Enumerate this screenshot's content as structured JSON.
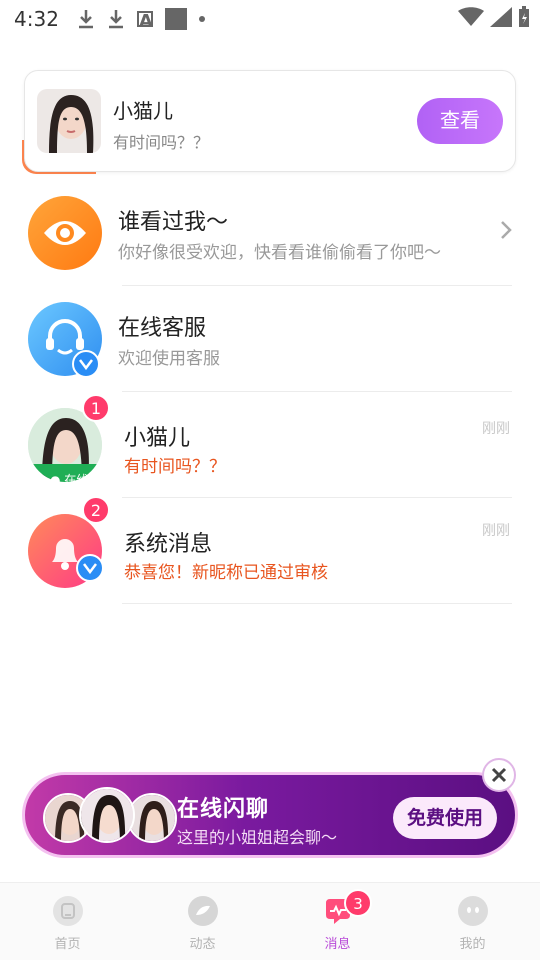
{
  "status_bar": {
    "time": "4:32"
  },
  "top_card": {
    "name": "小猫儿",
    "subtitle": "有时间吗？？",
    "button_label": "查看"
  },
  "list": [
    {
      "title": "谁看过我～",
      "subtitle": "你好像很受欢迎，快看看谁偷偷看了你吧～",
      "icon": "eye-icon",
      "color": "#ff8a1f"
    },
    {
      "title": "在线客服",
      "subtitle": "欢迎使用客服",
      "icon": "headset-icon",
      "color": "#3fa5f5"
    },
    {
      "title": "小猫儿",
      "subtitle": "有时间吗？？",
      "time": "刚刚",
      "badge": "1",
      "online_label": "在线"
    },
    {
      "title": "系统消息",
      "subtitle": "恭喜您！新昵称已通过审核",
      "time": "刚刚",
      "badge": "2",
      "icon": "bell-icon"
    }
  ],
  "promo": {
    "title": "在线闪聊",
    "subtitle": "这里的小姐姐超会聊～",
    "button_label": "免费使用"
  },
  "bottom_nav": [
    {
      "label": "首页",
      "icon": "home-icon"
    },
    {
      "label": "动态",
      "icon": "feed-icon"
    },
    {
      "label": "消息",
      "icon": "message-icon",
      "badge": "3",
      "active": true
    },
    {
      "label": "我的",
      "icon": "profile-icon"
    }
  ],
  "colors": {
    "accent": "#b162f5",
    "badge": "#ff3b6b",
    "alert_text": "#e8551f"
  }
}
